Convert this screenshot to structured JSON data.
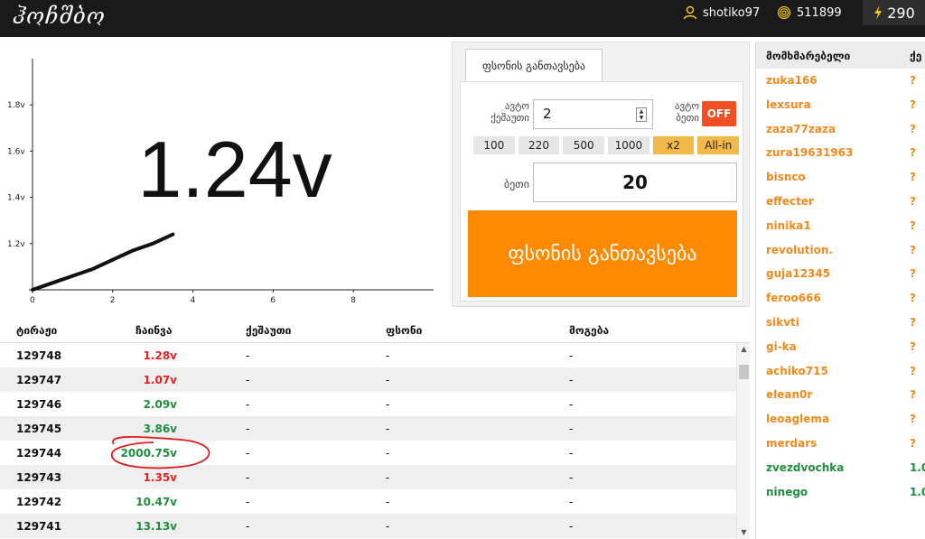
{
  "header": {
    "logo_text": "ჰოჩშბო",
    "username": "shotiko97",
    "points": "511899",
    "energy": "290",
    "user_icon": "user-icon",
    "points_icon": "fingerprint-icon",
    "energy_icon": "lightning-icon"
  },
  "game": {
    "multiplier": "1.24v"
  },
  "chart_data": {
    "type": "line",
    "x": [
      0,
      0.5,
      1,
      1.5,
      2,
      2.5,
      3,
      3.5
    ],
    "y": [
      1.0,
      1.03,
      1.06,
      1.09,
      1.13,
      1.17,
      1.2,
      1.24
    ],
    "y_ticks": [
      "1.8v",
      "1.6v",
      "1.4v",
      "1.2v"
    ],
    "x_ticks": [
      "0",
      "2",
      "4",
      "6",
      "8"
    ],
    "xlim": [
      0,
      10
    ],
    "ylim": [
      1.0,
      2.0
    ],
    "grid": false
  },
  "bet_panel": {
    "tab_label": "ფსონის განთავსება",
    "auto_coef_label": "ავტო ქეშაუთი",
    "auto_coef_value": "2",
    "auto_bet_label": "ავტო ბეთი",
    "auto_toggle": "OFF",
    "quick_amounts": [
      "100",
      "220",
      "500",
      "1000",
      "x2",
      "All-in"
    ],
    "bet_label": "ბეთი",
    "bet_value": "20",
    "place_bet_label": "ფსონის განთავსება",
    "toggle_color": "#f04e23",
    "button_color": "#ff8a00"
  },
  "bets_table": {
    "columns": [
      "ტირაჟი",
      "ჩაინვა",
      "ქეშაუთი",
      "ფსონი",
      "მოგება"
    ],
    "rows": [
      {
        "id": "129748",
        "mult": "1.28v",
        "color": "red",
        "cashout": "-",
        "bet": "-",
        "win": "-"
      },
      {
        "id": "129747",
        "mult": "1.07v",
        "color": "red",
        "cashout": "-",
        "bet": "-",
        "win": "-"
      },
      {
        "id": "129746",
        "mult": "2.09v",
        "color": "green",
        "cashout": "-",
        "bet": "-",
        "win": "-"
      },
      {
        "id": "129745",
        "mult": "3.86v",
        "color": "green",
        "cashout": "-",
        "bet": "-",
        "win": "-"
      },
      {
        "id": "129744",
        "mult": "2000.75v",
        "color": "green",
        "cashout": "-",
        "bet": "-",
        "win": "-"
      },
      {
        "id": "129743",
        "mult": "1.35v",
        "color": "red",
        "cashout": "-",
        "bet": "-",
        "win": "-"
      },
      {
        "id": "129742",
        "mult": "10.47v",
        "color": "green",
        "cashout": "-",
        "bet": "-",
        "win": "-"
      },
      {
        "id": "129741",
        "mult": "13.13v",
        "color": "green",
        "cashout": "-",
        "bet": "-",
        "win": "-"
      }
    ]
  },
  "users": {
    "col_user": "მომხმარებელი",
    "col_value": "ქე",
    "list": [
      {
        "name": "zuka166",
        "value": "?",
        "color": "orange"
      },
      {
        "name": "lexsura",
        "value": "?",
        "color": "orange"
      },
      {
        "name": "zaza77zaza",
        "value": "?",
        "color": "orange"
      },
      {
        "name": "zura19631963",
        "value": "?",
        "color": "orange"
      },
      {
        "name": "bisnco",
        "value": "?",
        "color": "orange"
      },
      {
        "name": "effecter",
        "value": "?",
        "color": "orange"
      },
      {
        "name": "ninika1",
        "value": "?",
        "color": "orange"
      },
      {
        "name": "revolution.",
        "value": "?",
        "color": "orange"
      },
      {
        "name": "guja12345",
        "value": "?",
        "color": "orange"
      },
      {
        "name": "feroo666",
        "value": "?",
        "color": "orange"
      },
      {
        "name": "sikvti",
        "value": "?",
        "color": "orange"
      },
      {
        "name": "gi-ka",
        "value": "?",
        "color": "orange"
      },
      {
        "name": "achiko715",
        "value": "?",
        "color": "orange"
      },
      {
        "name": "elean0r",
        "value": "?",
        "color": "orange"
      },
      {
        "name": "leoaglema",
        "value": "?",
        "color": "orange"
      },
      {
        "name": "merdars",
        "value": "?",
        "color": "orange"
      },
      {
        "name": "zvezdvochka",
        "value": "1.0",
        "color": "green"
      },
      {
        "name": "ninego",
        "value": "1.0",
        "color": "green"
      }
    ]
  },
  "colors": {
    "red": "#e02424",
    "green": "#1e8e3e",
    "orange": "#f08a1c",
    "annotation": "#e31b1b"
  }
}
